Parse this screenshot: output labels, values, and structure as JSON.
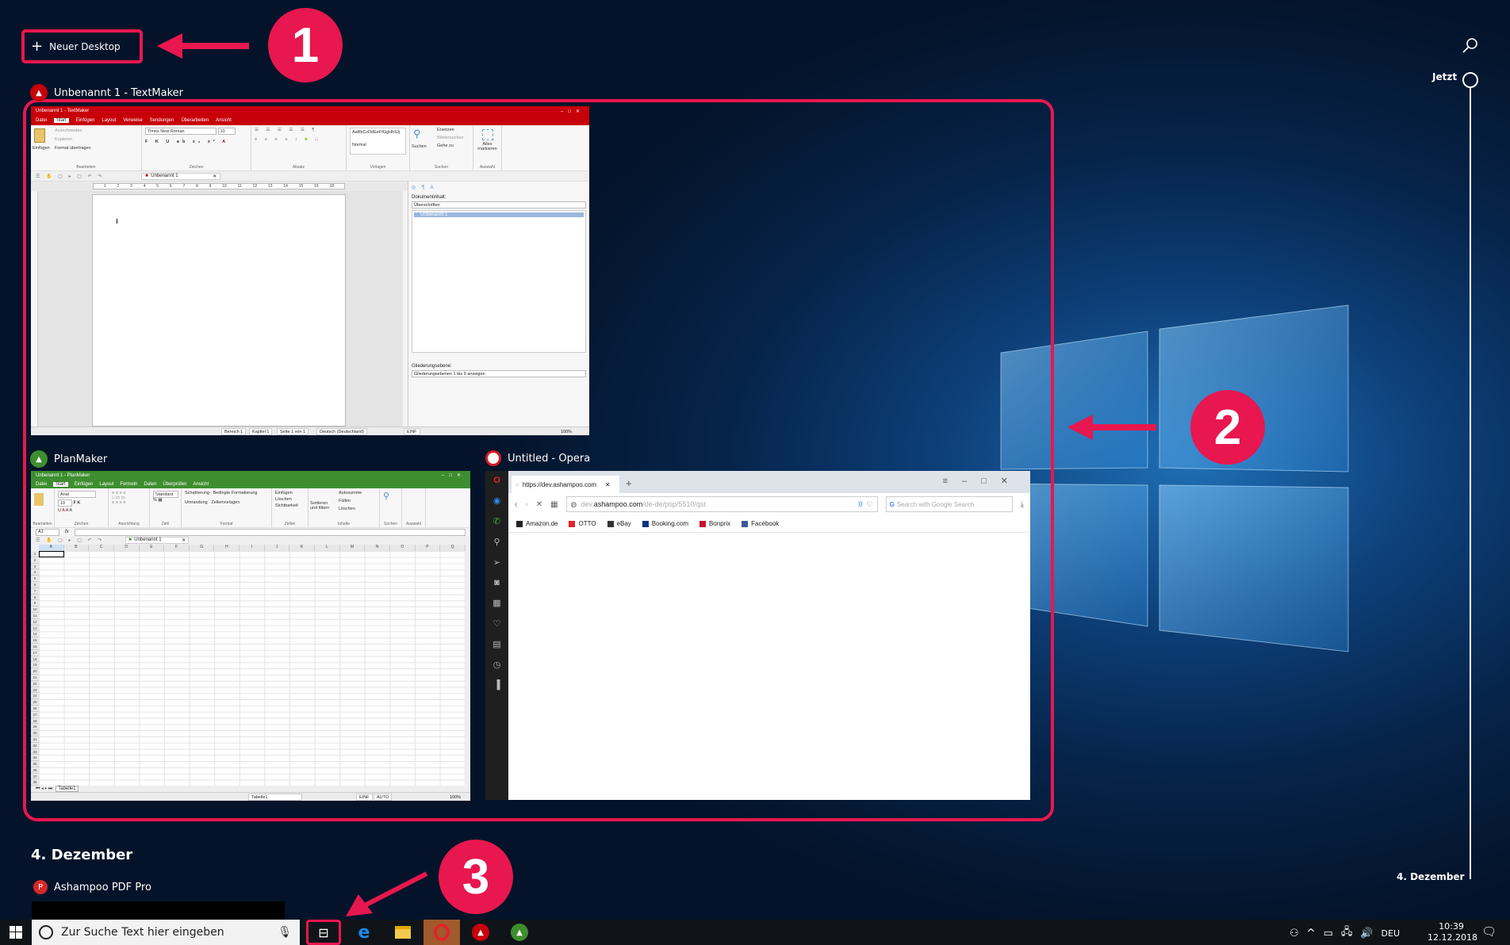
{
  "colors": {
    "accent": "#e8174f",
    "textmaker": "#c8000a",
    "planmaker": "#3e8e2f",
    "opera": "#d41a1f",
    "taskbar": "#101418"
  },
  "new_desktop": {
    "icon": "plus-icon",
    "label": "Neuer Desktop"
  },
  "callouts": [
    "1",
    "2",
    "3"
  ],
  "timeline": {
    "now_label": "Jetzt",
    "end_label": "4. Dezember",
    "search_icon": "search-icon"
  },
  "windows": {
    "textmaker": {
      "label": "Unbenannt 1 - TextMaker",
      "title": "Unbenannt 1 - TextMaker",
      "tabs": [
        "Datei",
        "Start",
        "Einfügen",
        "Layout",
        "Verweise",
        "Sendungen",
        "Überarbeiten",
        "Ansicht"
      ],
      "groups": [
        "Bearbeiten",
        "Zeichen",
        "Absatz",
        "Vorlagen",
        "Suchen",
        "Auswahl"
      ],
      "edit": {
        "paste": "Einfügen",
        "cut": "Ausschneiden",
        "copy": "Kopieren",
        "format": "Format übertragen"
      },
      "font": "Times New Roman",
      "size": "10",
      "style_preview": "AaBbCcDdEeFfGgHhIiJj",
      "style": "Normal",
      "search": {
        "find": "Suchen",
        "replace": "Ersetzen",
        "next": "Weitersuchen",
        "goto": "Gehe zu"
      },
      "select_all": "Alles markieren",
      "doc_tab": "Unbenannt 1",
      "ruler": [
        "1",
        "2",
        "3",
        "4",
        "5",
        "6",
        "7",
        "8",
        "9",
        "10",
        "11",
        "12",
        "13",
        "14",
        "15",
        "16",
        "18"
      ],
      "pane": {
        "content_label": "Dokumentinhalt:",
        "content_value": "Überschriften",
        "item": "Unbenannt 1",
        "level_label": "Gliederungsebene:",
        "level_value": "Gliederungsebenen 1 bis 9 anzeigen"
      },
      "status": [
        "Bereich 1",
        "Kapitel 1",
        "Seite 1 von 1",
        "Deutsch (Deutschland)",
        "EINF"
      ],
      "zoom": "100%"
    },
    "planmaker": {
      "label": "PlanMaker",
      "title": "Unbenannt 1 - PlanMaker",
      "tabs": [
        "Datei",
        "Start",
        "Einfügen",
        "Layout",
        "Formeln",
        "Daten",
        "Überprüfen",
        "Ansicht"
      ],
      "groups": [
        "Bearbeiten",
        "Zeichen",
        "Ausrichtung",
        "Zahl",
        "Format",
        "Zellen",
        "Inhalte",
        "Suchen",
        "Auswahl"
      ],
      "font": "Arial",
      "size": "10",
      "number_format": "Standard",
      "format": [
        "Schattierung",
        "Bedingte Formatierung",
        "Umrandung",
        "Zellenvorlagen"
      ],
      "cells": [
        "Einfügen",
        "Löschen",
        "Sichtbarkeit"
      ],
      "sort": "Sortieren und filtern",
      "content": [
        "Autosumme",
        "Füllen",
        "Löschen"
      ],
      "cell_ref": "A1",
      "doc_tab": "Unbenannt 1",
      "columns": [
        "A",
        "B",
        "C",
        "D",
        "E",
        "F",
        "G",
        "H",
        "I",
        "J",
        "K",
        "L",
        "M",
        "N",
        "O",
        "P",
        "Q"
      ],
      "row_count": 38,
      "sheet_tab": "Tabelle1",
      "status": {
        "sheet": "Tabelle1",
        "mode": "EINF",
        "calc": "AUTO",
        "zoom": "100%"
      }
    },
    "opera": {
      "label": "Untitled - Opera",
      "tab_title": "https://dev.ashampoo.com",
      "url_host_prefix": "dev.",
      "url_host": "ashampoo.com",
      "url_path": "/de-de/psp/5510/qst",
      "adblock_count": "0",
      "search_placeholder": "Search with Google Search",
      "bookmarks": [
        "Amazon.de",
        "OTTO",
        "eBay",
        "Booking.com",
        "Bonprix",
        "Facebook"
      ],
      "sidebar_icons": [
        "opera-logo-icon",
        "messenger-icon",
        "whatsapp-icon",
        "search-icon",
        "send-icon",
        "camera-icon",
        "speed-dial-icon",
        "heart-icon",
        "news-icon",
        "history-icon",
        "sidebar-toggle-icon"
      ]
    }
  },
  "history": {
    "date": "4. Dezember",
    "app_label": "Ashampoo PDF Pro"
  },
  "taskbar": {
    "search_placeholder": "Zur Suche Text hier eingeben",
    "apps": [
      "task-view-icon",
      "edge-icon",
      "file-explorer-icon",
      "opera-icon",
      "textmaker-icon",
      "planmaker-icon"
    ],
    "language": "DEU",
    "time": "10:39",
    "date": "12.12.2018"
  }
}
